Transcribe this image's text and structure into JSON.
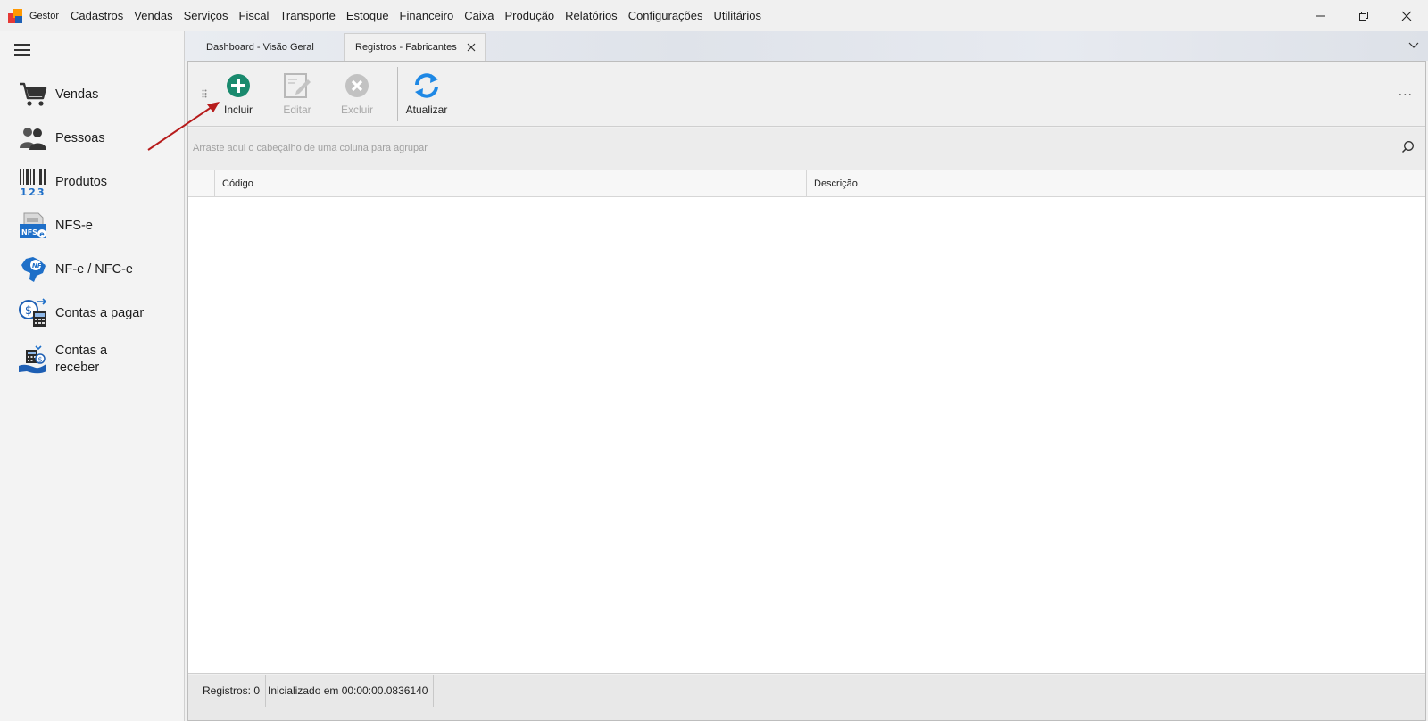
{
  "app": {
    "name": "Gestor",
    "menu": [
      "Cadastros",
      "Vendas",
      "Serviços",
      "Fiscal",
      "Transporte",
      "Estoque",
      "Financeiro",
      "Caixa",
      "Produção",
      "Relatórios",
      "Configurações",
      "Utilitários"
    ]
  },
  "window_controls": [
    "minimize-icon",
    "restore-icon",
    "close-icon"
  ],
  "sidebar": {
    "items": [
      {
        "label": "Vendas",
        "icon": "shopping-cart-icon"
      },
      {
        "label": "Pessoas",
        "icon": "people-icon"
      },
      {
        "label": "Produtos",
        "icon": "barcode-icon"
      },
      {
        "label": "NFS-e",
        "icon": "nfse-icon"
      },
      {
        "label": "NF-e / NFC-e",
        "icon": "nfe-brazil-map-icon"
      },
      {
        "label": "Contas a pagar",
        "icon": "accounts-payable-icon"
      },
      {
        "label": "Contas a receber",
        "icon": "accounts-receivable-icon"
      }
    ]
  },
  "tabs": [
    {
      "label": "Dashboard - Visão Geral",
      "active": false
    },
    {
      "label": "Registros - Fabricantes",
      "active": true
    }
  ],
  "toolbar": {
    "incluir": "Incluir",
    "editar": "Editar",
    "excluir": "Excluir",
    "atualizar": "Atualizar",
    "more": "..."
  },
  "grid": {
    "group_hint": "Arraste aqui o cabeçalho de uma coluna para agrupar",
    "columns": [
      "Código",
      "Descrição"
    ],
    "rows": []
  },
  "status": {
    "registros": "Registros: 0",
    "inicializado": "Inicializado em 00:00:00.0836140"
  },
  "colors": {
    "accent_green": "#1a8a6e",
    "accent_blue": "#1e88e5",
    "annotation_arrow": "#b71c1c"
  }
}
